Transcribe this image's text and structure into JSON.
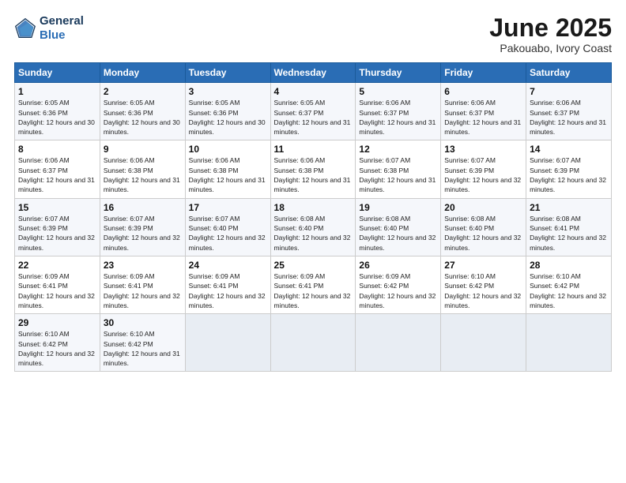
{
  "header": {
    "logo_general": "General",
    "logo_blue": "Blue",
    "month_year": "June 2025",
    "location": "Pakouabo, Ivory Coast"
  },
  "calendar": {
    "days_of_week": [
      "Sunday",
      "Monday",
      "Tuesday",
      "Wednesday",
      "Thursday",
      "Friday",
      "Saturday"
    ],
    "weeks": [
      [
        {
          "day": "1",
          "sunrise": "6:05 AM",
          "sunset": "6:36 PM",
          "daylight": "12 hours and 30 minutes."
        },
        {
          "day": "2",
          "sunrise": "6:05 AM",
          "sunset": "6:36 PM",
          "daylight": "12 hours and 30 minutes."
        },
        {
          "day": "3",
          "sunrise": "6:05 AM",
          "sunset": "6:36 PM",
          "daylight": "12 hours and 30 minutes."
        },
        {
          "day": "4",
          "sunrise": "6:05 AM",
          "sunset": "6:37 PM",
          "daylight": "12 hours and 31 minutes."
        },
        {
          "day": "5",
          "sunrise": "6:06 AM",
          "sunset": "6:37 PM",
          "daylight": "12 hours and 31 minutes."
        },
        {
          "day": "6",
          "sunrise": "6:06 AM",
          "sunset": "6:37 PM",
          "daylight": "12 hours and 31 minutes."
        },
        {
          "day": "7",
          "sunrise": "6:06 AM",
          "sunset": "6:37 PM",
          "daylight": "12 hours and 31 minutes."
        }
      ],
      [
        {
          "day": "8",
          "sunrise": "6:06 AM",
          "sunset": "6:37 PM",
          "daylight": "12 hours and 31 minutes."
        },
        {
          "day": "9",
          "sunrise": "6:06 AM",
          "sunset": "6:38 PM",
          "daylight": "12 hours and 31 minutes."
        },
        {
          "day": "10",
          "sunrise": "6:06 AM",
          "sunset": "6:38 PM",
          "daylight": "12 hours and 31 minutes."
        },
        {
          "day": "11",
          "sunrise": "6:06 AM",
          "sunset": "6:38 PM",
          "daylight": "12 hours and 31 minutes."
        },
        {
          "day": "12",
          "sunrise": "6:07 AM",
          "sunset": "6:38 PM",
          "daylight": "12 hours and 31 minutes."
        },
        {
          "day": "13",
          "sunrise": "6:07 AM",
          "sunset": "6:39 PM",
          "daylight": "12 hours and 32 minutes."
        },
        {
          "day": "14",
          "sunrise": "6:07 AM",
          "sunset": "6:39 PM",
          "daylight": "12 hours and 32 minutes."
        }
      ],
      [
        {
          "day": "15",
          "sunrise": "6:07 AM",
          "sunset": "6:39 PM",
          "daylight": "12 hours and 32 minutes."
        },
        {
          "day": "16",
          "sunrise": "6:07 AM",
          "sunset": "6:39 PM",
          "daylight": "12 hours and 32 minutes."
        },
        {
          "day": "17",
          "sunrise": "6:07 AM",
          "sunset": "6:40 PM",
          "daylight": "12 hours and 32 minutes."
        },
        {
          "day": "18",
          "sunrise": "6:08 AM",
          "sunset": "6:40 PM",
          "daylight": "12 hours and 32 minutes."
        },
        {
          "day": "19",
          "sunrise": "6:08 AM",
          "sunset": "6:40 PM",
          "daylight": "12 hours and 32 minutes."
        },
        {
          "day": "20",
          "sunrise": "6:08 AM",
          "sunset": "6:40 PM",
          "daylight": "12 hours and 32 minutes."
        },
        {
          "day": "21",
          "sunrise": "6:08 AM",
          "sunset": "6:41 PM",
          "daylight": "12 hours and 32 minutes."
        }
      ],
      [
        {
          "day": "22",
          "sunrise": "6:09 AM",
          "sunset": "6:41 PM",
          "daylight": "12 hours and 32 minutes."
        },
        {
          "day": "23",
          "sunrise": "6:09 AM",
          "sunset": "6:41 PM",
          "daylight": "12 hours and 32 minutes."
        },
        {
          "day": "24",
          "sunrise": "6:09 AM",
          "sunset": "6:41 PM",
          "daylight": "12 hours and 32 minutes."
        },
        {
          "day": "25",
          "sunrise": "6:09 AM",
          "sunset": "6:41 PM",
          "daylight": "12 hours and 32 minutes."
        },
        {
          "day": "26",
          "sunrise": "6:09 AM",
          "sunset": "6:42 PM",
          "daylight": "12 hours and 32 minutes."
        },
        {
          "day": "27",
          "sunrise": "6:10 AM",
          "sunset": "6:42 PM",
          "daylight": "12 hours and 32 minutes."
        },
        {
          "day": "28",
          "sunrise": "6:10 AM",
          "sunset": "6:42 PM",
          "daylight": "12 hours and 32 minutes."
        }
      ],
      [
        {
          "day": "29",
          "sunrise": "6:10 AM",
          "sunset": "6:42 PM",
          "daylight": "12 hours and 32 minutes."
        },
        {
          "day": "30",
          "sunrise": "6:10 AM",
          "sunset": "6:42 PM",
          "daylight": "12 hours and 31 minutes."
        },
        {
          "day": "",
          "sunrise": "",
          "sunset": "",
          "daylight": ""
        },
        {
          "day": "",
          "sunrise": "",
          "sunset": "",
          "daylight": ""
        },
        {
          "day": "",
          "sunrise": "",
          "sunset": "",
          "daylight": ""
        },
        {
          "day": "",
          "sunrise": "",
          "sunset": "",
          "daylight": ""
        },
        {
          "day": "",
          "sunrise": "",
          "sunset": "",
          "daylight": ""
        }
      ]
    ],
    "labels": {
      "sunrise": "Sunrise: ",
      "sunset": "Sunset: ",
      "daylight": "Daylight: "
    }
  }
}
